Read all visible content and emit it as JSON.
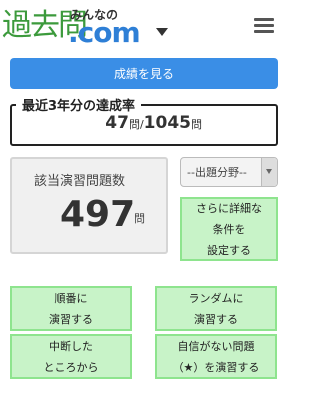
{
  "header": {
    "logo_kanji": "過去問",
    "logo_small": "みんなの",
    "logo_com": ".com",
    "menu_icon": "hamburger-menu-icon",
    "dropdown_icon": "caret-down-icon"
  },
  "results_button": {
    "label": "成績を見る"
  },
  "achievement": {
    "title": "最近3年分の達成率",
    "answered": "47",
    "unit1": "問",
    "separator": "/",
    "total": "1045",
    "unit2": "問"
  },
  "question_count": {
    "label": "該当演習問題数",
    "value": "497",
    "unit": "問"
  },
  "field_select": {
    "selected": "--出題分野--"
  },
  "detail_button": {
    "label": "さらに詳細な\n条件を\n設定する"
  },
  "practice_buttons": {
    "order": "順番に\n演習する",
    "random": "ランダムに\n演習する",
    "resume": "中断した\nところから",
    "unsure": "自信がない問題\n（★）を演習する"
  },
  "colors": {
    "primary_blue": "#3a8ee6",
    "green_bg": "#c8f3c8",
    "green_border": "#8ee48e",
    "logo_green": "#3c9a3c",
    "logo_blue": "#2e7fd6"
  }
}
